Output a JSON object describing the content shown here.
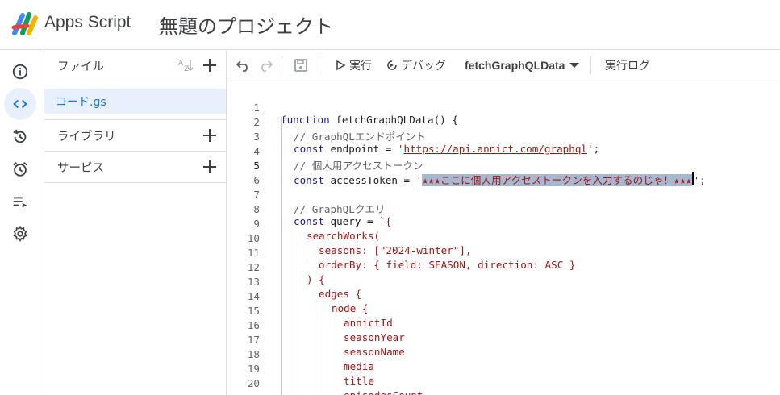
{
  "header": {
    "app_name": "Apps Script",
    "project_title": "無題のプロジェクト"
  },
  "rail": {
    "items": [
      {
        "icon": "info-icon"
      },
      {
        "icon": "code-editor-icon",
        "active": true
      },
      {
        "icon": "history-icon"
      },
      {
        "icon": "triggers-icon"
      },
      {
        "icon": "executions-icon"
      },
      {
        "icon": "settings-icon"
      }
    ]
  },
  "files_panel": {
    "files_label": "ファイル",
    "file_name": "コード.gs",
    "libraries_label": "ライブラリ",
    "services_label": "サービス"
  },
  "toolbar": {
    "run_label": "実行",
    "debug_label": "デバッグ",
    "function_name": "fetchGraphQLData",
    "log_label": "実行ログ"
  },
  "editor": {
    "current_line": 5,
    "lines": [
      {
        "n": "1",
        "text": "function fetchGraphQLData() {"
      },
      {
        "n": "2",
        "text": "  // GraphQLエンドポイント"
      },
      {
        "n": "3",
        "text": "  const endpoint = 'https://api.annict.com/graphql';"
      },
      {
        "n": "4",
        "text": "  // 個人用アクセストークン"
      },
      {
        "n": "5",
        "text": "  const accessToken = '★★★ここに個人用アクセストークンを入力するのじゃ！★★★';"
      },
      {
        "n": "6",
        "text": ""
      },
      {
        "n": "7",
        "text": "  // GraphQLクエリ"
      },
      {
        "n": "8",
        "text": "  const query = `{"
      },
      {
        "n": "9",
        "text": "    searchWorks("
      },
      {
        "n": "10",
        "text": "      seasons: [\"2024-winter\"],"
      },
      {
        "n": "11",
        "text": "      orderBy: { field: SEASON, direction: ASC }"
      },
      {
        "n": "12",
        "text": "    ) {"
      },
      {
        "n": "13",
        "text": "      edges {"
      },
      {
        "n": "14",
        "text": "        node {"
      },
      {
        "n": "15",
        "text": "          annictId"
      },
      {
        "n": "16",
        "text": "          seasonYear"
      },
      {
        "n": "17",
        "text": "          seasonName"
      },
      {
        "n": "18",
        "text": "          media"
      },
      {
        "n": "19",
        "text": "          title"
      },
      {
        "n": "20",
        "text": "          episodesCount"
      }
    ],
    "tokens": {
      "l1_kw": "function",
      "l1_rest": " fetchGraphQLData() {",
      "l2": "// GraphQLエンドポイント",
      "l3_kw": "const",
      "l3_mid": " endpoint = ",
      "l3_q1": "'",
      "l3_url": "https://api.annict.com/graphql",
      "l3_q2": "'",
      "l3_end": ";",
      "l4": "// 個人用アクセストークン",
      "l5_kw": "const",
      "l5_mid": " accessToken = ",
      "l5_q1": "'",
      "l5_sel": "★★★ここに個人用アクセストークンを入力するのじゃ！★★★",
      "l5_q2": "'",
      "l5_end": ";",
      "l7": "// GraphQLクエリ",
      "l8_kw": "const",
      "l8_mid": " query = ",
      "l8_tpl": "`{",
      "l9": "searchWorks(",
      "l10": "seasons: [\"2024-winter\"],",
      "l11": "orderBy: { field: SEASON, direction: ASC }",
      "l12": ") {",
      "l13": "edges {",
      "l14": "node {",
      "l15": "annictId",
      "l16": "seasonYear",
      "l17": "seasonName",
      "l18": "media",
      "l19": "title",
      "l20": "episodesCount"
    }
  }
}
